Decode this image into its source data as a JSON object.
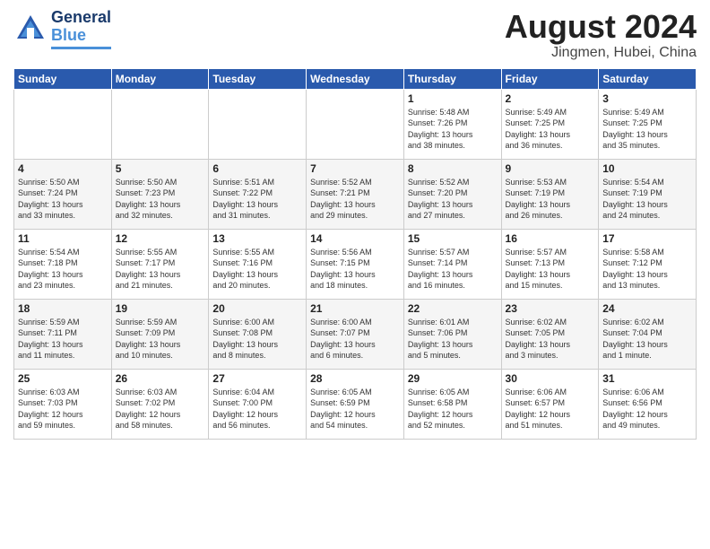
{
  "logo": {
    "part1": "General",
    "part2": "Blue"
  },
  "title": "August 2024",
  "location": "Jingmen, Hubei, China",
  "weekdays": [
    "Sunday",
    "Monday",
    "Tuesday",
    "Wednesday",
    "Thursday",
    "Friday",
    "Saturday"
  ],
  "weeks": [
    [
      {
        "day": "",
        "info": ""
      },
      {
        "day": "",
        "info": ""
      },
      {
        "day": "",
        "info": ""
      },
      {
        "day": "",
        "info": ""
      },
      {
        "day": "1",
        "info": "Sunrise: 5:48 AM\nSunset: 7:26 PM\nDaylight: 13 hours\nand 38 minutes."
      },
      {
        "day": "2",
        "info": "Sunrise: 5:49 AM\nSunset: 7:25 PM\nDaylight: 13 hours\nand 36 minutes."
      },
      {
        "day": "3",
        "info": "Sunrise: 5:49 AM\nSunset: 7:25 PM\nDaylight: 13 hours\nand 35 minutes."
      }
    ],
    [
      {
        "day": "4",
        "info": "Sunrise: 5:50 AM\nSunset: 7:24 PM\nDaylight: 13 hours\nand 33 minutes."
      },
      {
        "day": "5",
        "info": "Sunrise: 5:50 AM\nSunset: 7:23 PM\nDaylight: 13 hours\nand 32 minutes."
      },
      {
        "day": "6",
        "info": "Sunrise: 5:51 AM\nSunset: 7:22 PM\nDaylight: 13 hours\nand 31 minutes."
      },
      {
        "day": "7",
        "info": "Sunrise: 5:52 AM\nSunset: 7:21 PM\nDaylight: 13 hours\nand 29 minutes."
      },
      {
        "day": "8",
        "info": "Sunrise: 5:52 AM\nSunset: 7:20 PM\nDaylight: 13 hours\nand 27 minutes."
      },
      {
        "day": "9",
        "info": "Sunrise: 5:53 AM\nSunset: 7:19 PM\nDaylight: 13 hours\nand 26 minutes."
      },
      {
        "day": "10",
        "info": "Sunrise: 5:54 AM\nSunset: 7:19 PM\nDaylight: 13 hours\nand 24 minutes."
      }
    ],
    [
      {
        "day": "11",
        "info": "Sunrise: 5:54 AM\nSunset: 7:18 PM\nDaylight: 13 hours\nand 23 minutes."
      },
      {
        "day": "12",
        "info": "Sunrise: 5:55 AM\nSunset: 7:17 PM\nDaylight: 13 hours\nand 21 minutes."
      },
      {
        "day": "13",
        "info": "Sunrise: 5:55 AM\nSunset: 7:16 PM\nDaylight: 13 hours\nand 20 minutes."
      },
      {
        "day": "14",
        "info": "Sunrise: 5:56 AM\nSunset: 7:15 PM\nDaylight: 13 hours\nand 18 minutes."
      },
      {
        "day": "15",
        "info": "Sunrise: 5:57 AM\nSunset: 7:14 PM\nDaylight: 13 hours\nand 16 minutes."
      },
      {
        "day": "16",
        "info": "Sunrise: 5:57 AM\nSunset: 7:13 PM\nDaylight: 13 hours\nand 15 minutes."
      },
      {
        "day": "17",
        "info": "Sunrise: 5:58 AM\nSunset: 7:12 PM\nDaylight: 13 hours\nand 13 minutes."
      }
    ],
    [
      {
        "day": "18",
        "info": "Sunrise: 5:59 AM\nSunset: 7:11 PM\nDaylight: 13 hours\nand 11 minutes."
      },
      {
        "day": "19",
        "info": "Sunrise: 5:59 AM\nSunset: 7:09 PM\nDaylight: 13 hours\nand 10 minutes."
      },
      {
        "day": "20",
        "info": "Sunrise: 6:00 AM\nSunset: 7:08 PM\nDaylight: 13 hours\nand 8 minutes."
      },
      {
        "day": "21",
        "info": "Sunrise: 6:00 AM\nSunset: 7:07 PM\nDaylight: 13 hours\nand 6 minutes."
      },
      {
        "day": "22",
        "info": "Sunrise: 6:01 AM\nSunset: 7:06 PM\nDaylight: 13 hours\nand 5 minutes."
      },
      {
        "day": "23",
        "info": "Sunrise: 6:02 AM\nSunset: 7:05 PM\nDaylight: 13 hours\nand 3 minutes."
      },
      {
        "day": "24",
        "info": "Sunrise: 6:02 AM\nSunset: 7:04 PM\nDaylight: 13 hours\nand 1 minute."
      }
    ],
    [
      {
        "day": "25",
        "info": "Sunrise: 6:03 AM\nSunset: 7:03 PM\nDaylight: 12 hours\nand 59 minutes."
      },
      {
        "day": "26",
        "info": "Sunrise: 6:03 AM\nSunset: 7:02 PM\nDaylight: 12 hours\nand 58 minutes."
      },
      {
        "day": "27",
        "info": "Sunrise: 6:04 AM\nSunset: 7:00 PM\nDaylight: 12 hours\nand 56 minutes."
      },
      {
        "day": "28",
        "info": "Sunrise: 6:05 AM\nSunset: 6:59 PM\nDaylight: 12 hours\nand 54 minutes."
      },
      {
        "day": "29",
        "info": "Sunrise: 6:05 AM\nSunset: 6:58 PM\nDaylight: 12 hours\nand 52 minutes."
      },
      {
        "day": "30",
        "info": "Sunrise: 6:06 AM\nSunset: 6:57 PM\nDaylight: 12 hours\nand 51 minutes."
      },
      {
        "day": "31",
        "info": "Sunrise: 6:06 AM\nSunset: 6:56 PM\nDaylight: 12 hours\nand 49 minutes."
      }
    ]
  ]
}
